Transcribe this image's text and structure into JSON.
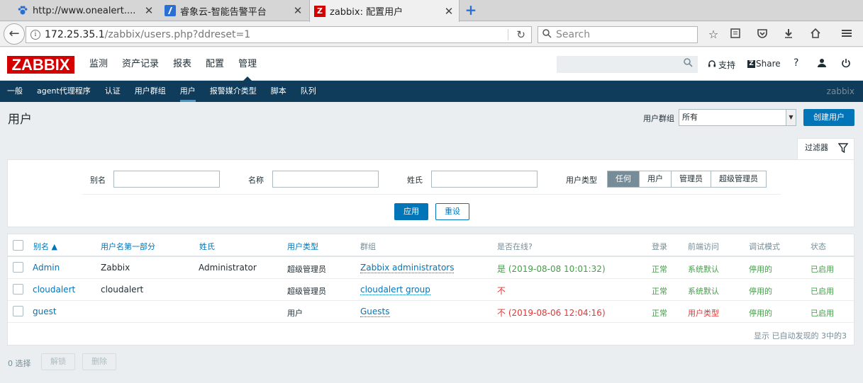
{
  "browser": {
    "tabs": [
      {
        "label": "http://www.onealert....",
        "icon": "paw-icon"
      },
      {
        "label": "睿象云-智能告警平台",
        "icon": "cloud-logo-icon"
      },
      {
        "label": "zabbix: 配置用户",
        "icon": "zabbix-z-icon"
      }
    ],
    "url_host": "172.25.35.1",
    "url_path": "/zabbix/users.php?ddreset=1",
    "search_placeholder": "Search"
  },
  "header": {
    "logo": "ZABBIX",
    "menu": [
      "监测",
      "资产记录",
      "报表",
      "配置",
      "管理"
    ],
    "menu_selected": "管理",
    "support_label": "支持",
    "share_label": "Share",
    "help_label": "?"
  },
  "submenu": {
    "items": [
      "一般",
      "agent代理程序",
      "认证",
      "用户群组",
      "用户",
      "报警媒介类型",
      "脚本",
      "队列"
    ],
    "selected": "用户",
    "server_name": "zabbix"
  },
  "page": {
    "title": "用户",
    "group_label": "用户群组",
    "group_value": "所有",
    "create_button": "创建用户"
  },
  "filter": {
    "tab_label": "过滤器",
    "alias_label": "别名",
    "name_label": "名称",
    "surname_label": "姓氏",
    "type_label": "用户类型",
    "type_options": [
      "任何",
      "用户",
      "管理员",
      "超级管理员"
    ],
    "type_selected": "任何",
    "apply_button": "应用",
    "reset_button": "重设"
  },
  "table": {
    "columns": [
      "别名 ▲",
      "用户名第一部分",
      "姓氏",
      "用户类型",
      "群组",
      "是否在线?",
      "登录",
      "前端访问",
      "调试模式",
      "状态"
    ],
    "rows": [
      {
        "alias": "Admin",
        "name": "Zabbix",
        "surname": "Administrator",
        "type": "超级管理员",
        "group": "Zabbix administrators",
        "online": "是 (2019-08-08 10:01:32)",
        "online_status": "yes",
        "login": "正常",
        "frontend": "系统默认",
        "frontend_status": "default",
        "debug": "停用的",
        "status": "已启用"
      },
      {
        "alias": "cloudalert",
        "name": "cloudalert",
        "surname": "",
        "type": "超级管理员",
        "group": "cloudalert group",
        "online": "不",
        "online_status": "no",
        "login": "正常",
        "frontend": "系统默认",
        "frontend_status": "default",
        "debug": "停用的",
        "status": "已启用"
      },
      {
        "alias": "guest",
        "name": "",
        "surname": "",
        "type": "用户",
        "group": "Guests",
        "online": "不 (2019-08-06 12:04:16)",
        "online_status": "no",
        "login": "正常",
        "frontend": "用户类型",
        "frontend_status": "user-type",
        "debug": "停用的",
        "status": "已启用"
      }
    ],
    "footer": "显示 已自动发现的 3中的3"
  },
  "actions": {
    "selected_count": "0 选择",
    "unblock_button": "解锁",
    "delete_button": "删除"
  },
  "colors": {
    "zabbix_red": "#d40000",
    "nav_dark": "#0f3c5a",
    "link_blue": "#0275b8",
    "ok_green": "#429e47",
    "bad_red": "#e33734"
  }
}
